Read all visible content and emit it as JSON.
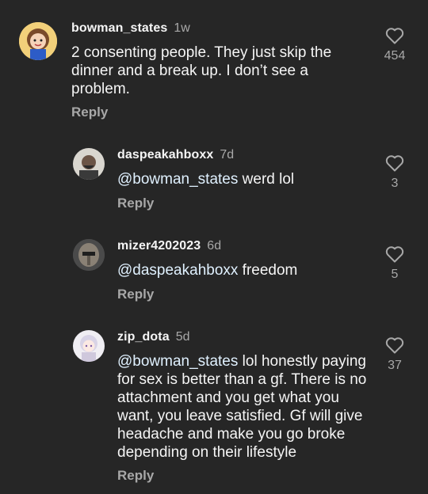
{
  "comments": [
    {
      "username": "bowman_states",
      "time": "1w",
      "mention": "",
      "text": "2 consenting people. They just skip the dinner and a break up. I don’t see a problem.",
      "reply_label": "Reply",
      "likes": "454",
      "avatar_icon": "cartoon-girl-avatar"
    },
    {
      "username": "daspeakahboxx",
      "time": "7d",
      "mention": "@bowman_states",
      "text": " werd lol",
      "reply_label": "Reply",
      "likes": "3",
      "avatar_icon": "man-avatar"
    },
    {
      "username": "mizer4202023",
      "time": "6d",
      "mention": "@daspeakahboxx",
      "text": " freedom",
      "reply_label": "Reply",
      "likes": "5",
      "avatar_icon": "helmet-avatar"
    },
    {
      "username": "zip_dota",
      "time": "5d",
      "mention": "@bowman_states",
      "text": " lol honestly paying for sex is better than a gf. There is no attachment and you get what you want,  you leave satisfied. Gf will give headache and make you go broke depending on their lifestyle",
      "reply_label": "Reply",
      "likes": "37",
      "avatar_icon": "anime-girl-avatar"
    }
  ]
}
